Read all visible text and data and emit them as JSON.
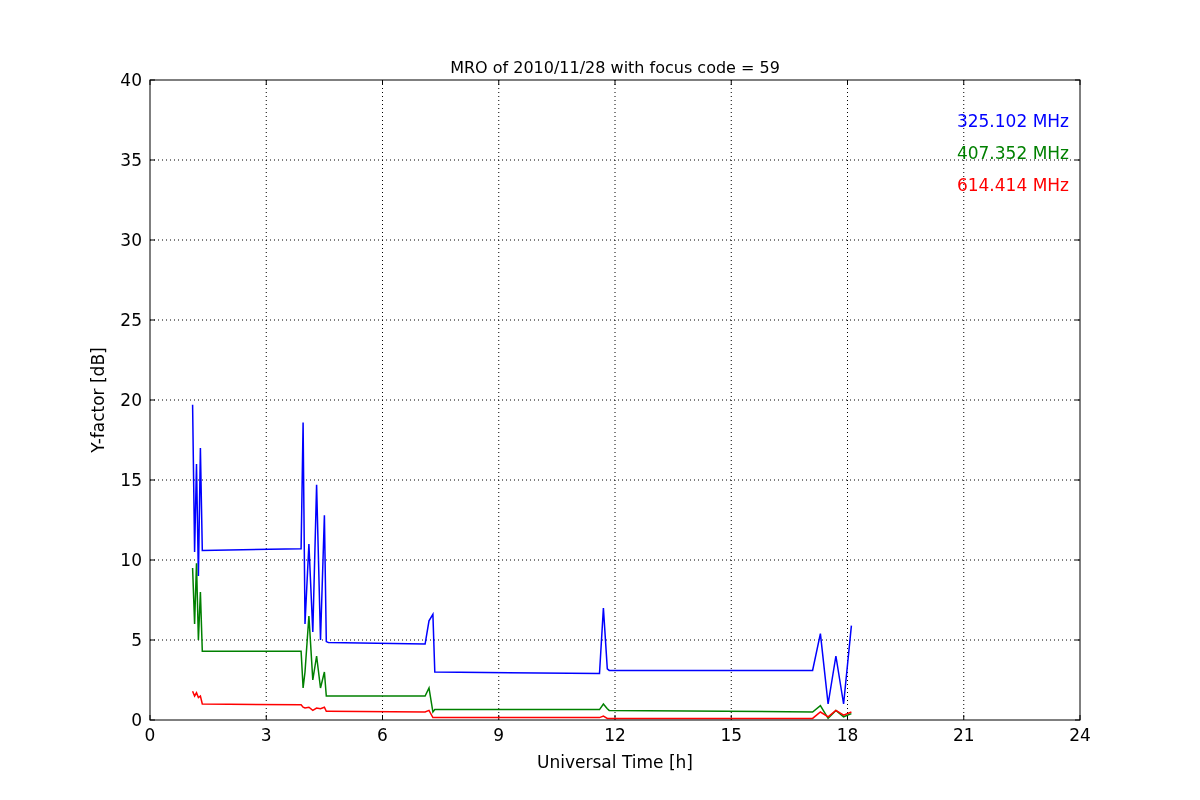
{
  "figure": {
    "chart_data": {
      "type": "line",
      "title": "MRO of 2010/11/28 with focus code = 59",
      "xlabel": "Universal Time [h]",
      "ylabel": "Y-factor [dB]",
      "x": [
        1.1,
        1.15,
        1.2,
        1.25,
        1.3,
        1.35,
        3.9,
        3.95,
        4.0,
        4.1,
        4.2,
        4.3,
        4.4,
        4.5,
        4.55,
        4.6,
        7.1,
        7.2,
        7.3,
        7.35,
        11.6,
        11.7,
        11.8,
        11.85,
        17.1,
        17.3,
        17.5,
        17.7,
        17.9,
        18.1
      ],
      "series": [
        {
          "name": "325.102 MHz",
          "color": "#0000ff",
          "values": [
            19.7,
            10.5,
            16,
            9,
            17,
            10.6,
            10.7,
            18.6,
            6,
            11,
            5.5,
            14.7,
            5,
            12.8,
            4.9,
            4.85,
            4.75,
            6.2,
            6.6,
            3,
            2.9,
            7,
            3.2,
            3.1,
            3.1,
            5.4,
            1,
            4,
            1,
            5.9
          ]
        },
        {
          "name": "407.352 MHz",
          "color": "#008000",
          "values": [
            9.5,
            6,
            9.8,
            5,
            8,
            4.3,
            4.3,
            2,
            3,
            6.5,
            2.5,
            4,
            2,
            3,
            1.5,
            1.5,
            1.5,
            2,
            0.5,
            0.65,
            0.65,
            1,
            0.7,
            0.6,
            0.5,
            0.9,
            0.1,
            0.6,
            0.2,
            0.4
          ]
        },
        {
          "name": "614.414 MHz",
          "color": "#ff0000",
          "values": [
            1.8,
            1.5,
            1.7,
            1.4,
            1.5,
            1,
            0.95,
            0.8,
            0.75,
            0.8,
            0.6,
            0.75,
            0.7,
            0.8,
            0.55,
            0.55,
            0.5,
            0.6,
            0.15,
            0.15,
            0.15,
            0.25,
            0.1,
            0.1,
            0.1,
            0.5,
            0.2,
            0.6,
            0.3,
            0.5
          ]
        }
      ],
      "xlim": [
        0,
        24
      ],
      "ylim": [
        0,
        40
      ],
      "xticks": [
        0,
        3,
        6,
        9,
        12,
        15,
        18,
        21,
        24
      ],
      "yticks": [
        0,
        5,
        10,
        15,
        20,
        25,
        30,
        35,
        40
      ],
      "grid": true
    }
  }
}
